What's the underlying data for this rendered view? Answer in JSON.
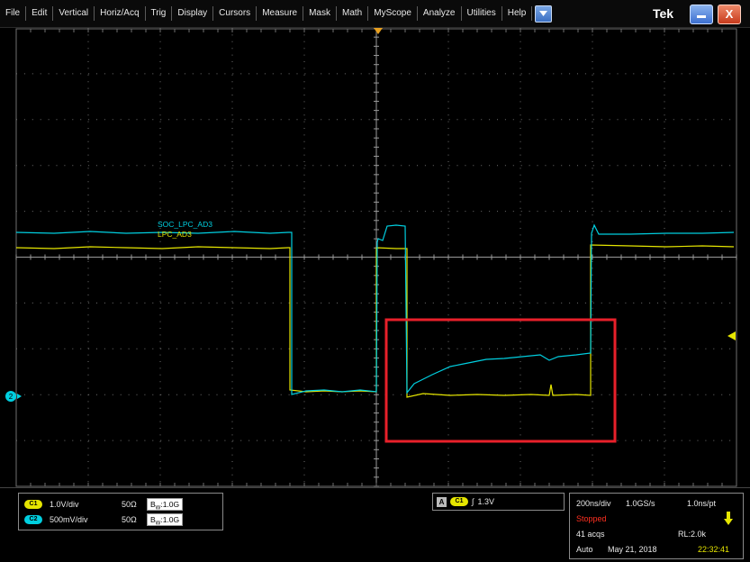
{
  "menu": {
    "items": [
      "File",
      "Edit",
      "Vertical",
      "Horiz/Acq",
      "Trig",
      "Display",
      "Cursors",
      "Measure",
      "Mask",
      "Math",
      "MyScope",
      "Analyze",
      "Utilities",
      "Help"
    ],
    "brand": "Tek",
    "close_glyph": "X"
  },
  "waveform_labels": {
    "ch_cyan": "SOC_LPC_AD3",
    "ch_yellow": "LPC_AD3"
  },
  "markers": {
    "ch2_marker": "2"
  },
  "colors": {
    "ch1": "#e6e600",
    "ch2": "#00cfe0",
    "highlight": "#e8202a",
    "graticule": "#6f6f6f",
    "trigger_marker": "#e8a020"
  },
  "channels": [
    {
      "id": "C1",
      "scale": "1.0V/div",
      "impedance": "50Ω",
      "bw_prefix": "B",
      "bw_sub": "W",
      "bw": ":1.0G"
    },
    {
      "id": "C2",
      "scale": "500mV/div",
      "impedance": "50Ω",
      "bw_prefix": "B",
      "bw_sub": "W",
      "bw": ":1.0G"
    }
  ],
  "trigger": {
    "source_box": "A",
    "source": "C1",
    "slope_glyph": "∫",
    "level": "1.3V"
  },
  "acquisition": {
    "timebase": "200ns/div",
    "sample_rate": "1.0GS/s",
    "resolution": "1.0ns/pt",
    "state": "Stopped",
    "acqs": "41 acqs",
    "record_length": "RL:2.0k",
    "mode": "Auto",
    "date": "May 21, 2018",
    "time": "22:32:41"
  }
}
